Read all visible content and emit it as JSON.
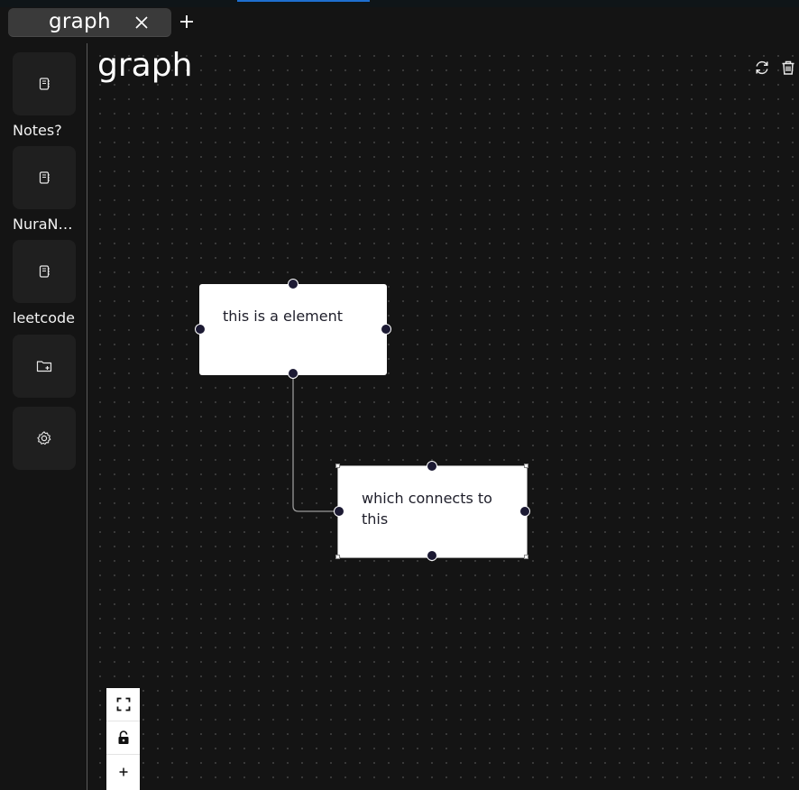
{
  "tabs": [
    {
      "label": "graph",
      "active": true
    }
  ],
  "icons": {
    "tab_close": "close-icon",
    "tab_add": "plus-icon",
    "notebook": "notebook-icon",
    "new_folder": "folder-plus-icon",
    "settings": "gear-icon",
    "refresh": "refresh-icon",
    "delete": "trash-icon",
    "fit_view": "fit-view-icon",
    "lock": "unlock-icon",
    "zoom_in": "plus-icon"
  },
  "sidebar": {
    "items": [
      {
        "label": "Notes?",
        "icon": "notebook-icon"
      },
      {
        "label": "NuraNotes",
        "icon": "notebook-icon"
      },
      {
        "label": "leetcode",
        "icon": "notebook-icon"
      }
    ],
    "new_folder_icon": "folder-plus-icon",
    "settings_icon": "gear-icon"
  },
  "page": {
    "title": "graph"
  },
  "graph": {
    "nodes": [
      {
        "id": "n1",
        "text": "this is a element",
        "selected": false
      },
      {
        "id": "n2",
        "text": "which connects to this",
        "selected": true
      }
    ],
    "edges": [
      {
        "from": "n1",
        "to": "n2"
      }
    ]
  },
  "controls": {
    "items": [
      "fit-view-icon",
      "unlock-icon",
      "plus-icon"
    ]
  },
  "colors": {
    "background": "#141414",
    "panel": "#1f1f1f",
    "tab": "#3a3a3a",
    "node": "#ffffff",
    "handle": "#1c1a33",
    "accent": "#1e6fd0"
  }
}
